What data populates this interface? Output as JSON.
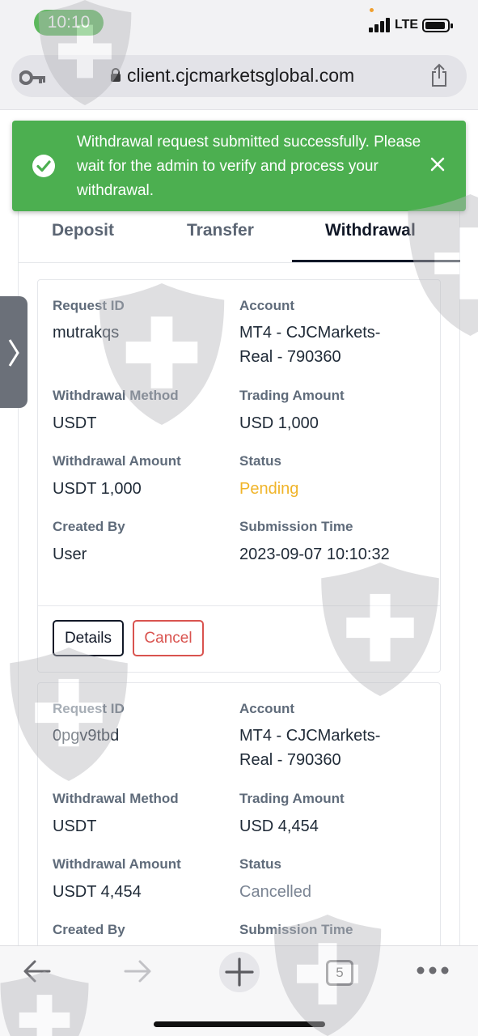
{
  "status_bar": {
    "time": "10:10",
    "network": "LTE"
  },
  "browser": {
    "url": "client.cjcmarketsglobal.com",
    "tab_count": "5"
  },
  "toast": {
    "message": "Withdrawal request submitted successfully. Please wait for the admin to verify and process your withdrawal.",
    "color": "#4caf50"
  },
  "tabs": [
    {
      "label": "Deposit",
      "active": false
    },
    {
      "label": "Transfer",
      "active": false
    },
    {
      "label": "Withdrawal",
      "active": true
    }
  ],
  "labels": {
    "request_id": "Request ID",
    "account": "Account",
    "withdrawal_method": "Withdrawal Method",
    "trading_amount": "Trading Amount",
    "withdrawal_amount": "Withdrawal Amount",
    "status": "Status",
    "created_by": "Created By",
    "submission_time": "Submission Time"
  },
  "withdrawals": [
    {
      "request_id": "mutrakqs",
      "account_line1": "MT4 - CJCMarkets-",
      "account_line2": "Real - 790360",
      "method": "USDT",
      "trading_amount": "USD 1,000",
      "withdrawal_amount": "USDT 1,000",
      "status": "Pending",
      "status_color": "#f0b429",
      "created_by": "User",
      "submission_time": "2023-09-07 10:10:32",
      "details_label": "Details",
      "cancel_label": "Cancel"
    },
    {
      "request_id": "0pgv9tbd",
      "account_line1": "MT4 - CJCMarkets-",
      "account_line2": "Real - 790360",
      "method": "USDT",
      "trading_amount": "USD 4,454",
      "withdrawal_amount": "USDT 4,454",
      "status": "Cancelled",
      "status_color": "#7a8493"
    }
  ],
  "icons": [
    "key-icon",
    "lock-icon",
    "share-icon",
    "check-circle-icon",
    "close-icon",
    "chevron-right-icon",
    "back-arrow-icon",
    "forward-arrow-icon",
    "plus-icon",
    "tabs-icon",
    "more-icon"
  ]
}
